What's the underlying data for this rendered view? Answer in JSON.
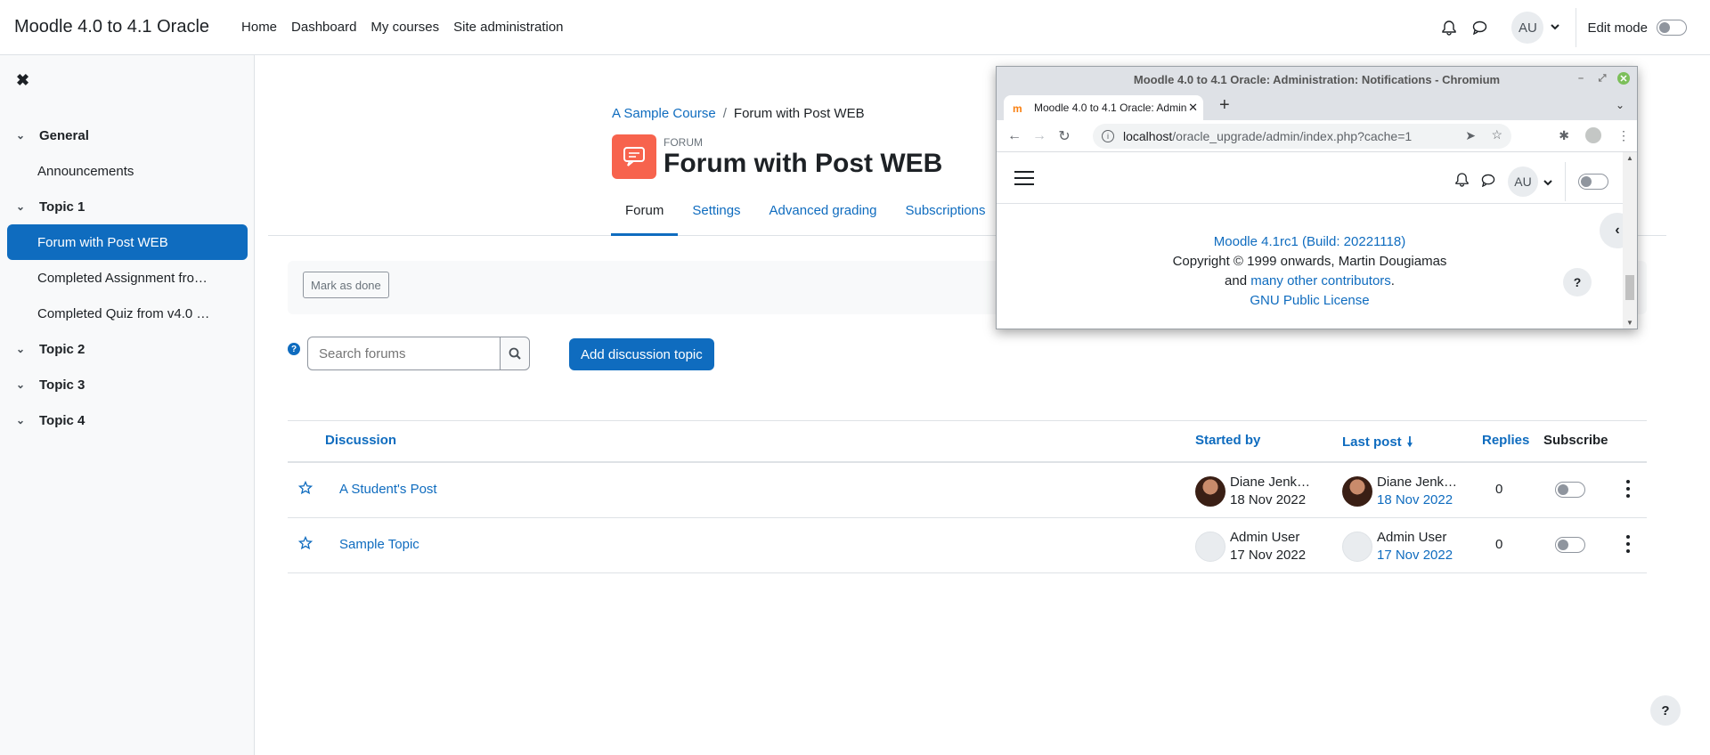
{
  "navbar": {
    "brand": "Moodle 4.0 to 4.1 Oracle",
    "items": [
      "Home",
      "Dashboard",
      "My courses",
      "Site administration"
    ],
    "user_initials": "AU",
    "edit_mode_label": "Edit mode"
  },
  "course_index": {
    "sections": [
      {
        "title": "General",
        "items": [
          "Announcements"
        ]
      },
      {
        "title": "Topic 1",
        "items": [
          "Forum with Post WEB",
          "Completed Assignment fro…",
          "Completed Quiz from v4.0 …"
        ]
      },
      {
        "title": "Topic 2",
        "items": []
      },
      {
        "title": "Topic 3",
        "items": []
      },
      {
        "title": "Topic 4",
        "items": []
      }
    ]
  },
  "breadcrumb": {
    "course": "A Sample Course",
    "separator": "/",
    "current": "Forum with Post WEB"
  },
  "activity": {
    "type": "FORUM",
    "title": "Forum with Post WEB"
  },
  "tabs": [
    "Forum",
    "Settings",
    "Advanced grading",
    "Subscriptions"
  ],
  "completion": {
    "mark_done_label": "Mark as done"
  },
  "search": {
    "placeholder": "Search forums"
  },
  "add_topic_label": "Add discussion topic",
  "table": {
    "headers": {
      "discussion": "Discussion",
      "started_by": "Started by",
      "last_post": "Last post",
      "replies": "Replies",
      "subscribe": "Subscribe"
    },
    "rows": [
      {
        "title": "A Student's Post",
        "started_name": "Diane Jenk…",
        "started_date": "18 Nov 2022",
        "last_name": "Diane Jenk…",
        "last_date": "18 Nov 2022",
        "replies": "0"
      },
      {
        "title": "Sample Topic",
        "started_name": "Admin User",
        "started_date": "17 Nov 2022",
        "last_name": "Admin User",
        "last_date": "17 Nov 2022",
        "replies": "0"
      }
    ]
  },
  "chromium": {
    "window_title": "Moodle 4.0 to 4.1 Oracle: Administration: Notifications - Chromium",
    "tab_title": "Moodle 4.0 to 4.1 Oracle: Admin",
    "url_host": "localhost",
    "url_path": "/oracle_upgrade/admin/index.php?cache=1",
    "inner_user_initials": "AU",
    "footer": {
      "version": "Moodle 4.1rc1 (Build: 20221118)",
      "copyright": "Copyright © 1999 onwards, Martin Dougiamas",
      "and_text": "and",
      "contributors": "many other contributors",
      "period": ".",
      "license": "GNU Public License"
    }
  },
  "colors": {
    "primary": "#0f6cbf",
    "forum_icon_bg": "#f7634d",
    "text": "#1d2125"
  }
}
